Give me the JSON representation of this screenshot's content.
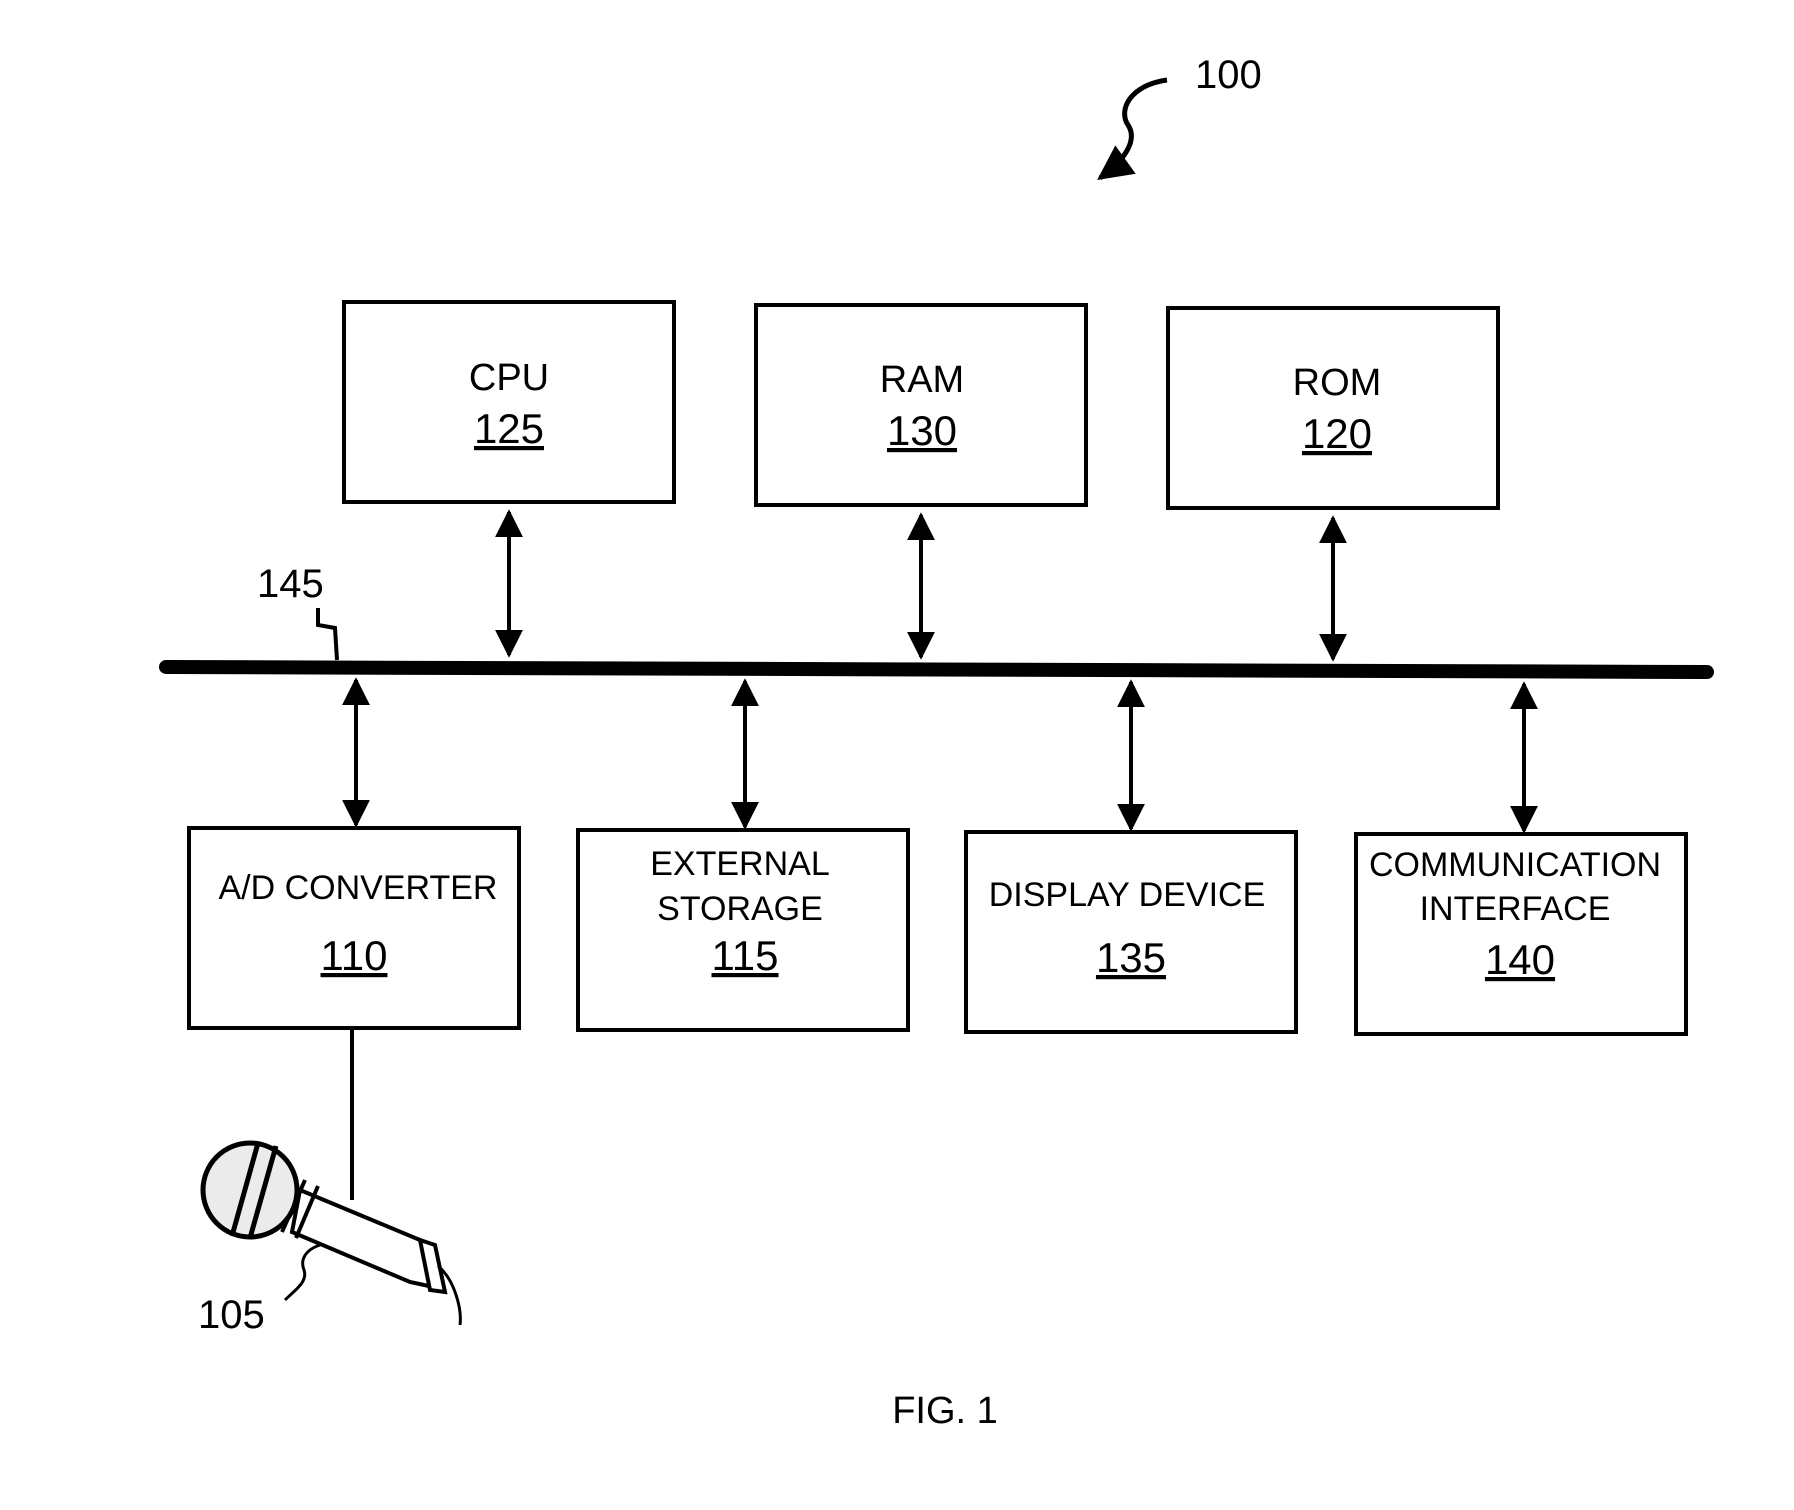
{
  "figure": {
    "caption": "FIG. 1",
    "system_ref": "100",
    "bus_ref": "145",
    "microphone_ref": "105"
  },
  "top_components": [
    {
      "name": "CPU",
      "ref": "125"
    },
    {
      "name": "RAM",
      "ref": "130"
    },
    {
      "name": "ROM",
      "ref": "120"
    }
  ],
  "bottom_components": [
    {
      "lines": [
        "A/D CONVERTER"
      ],
      "ref": "110"
    },
    {
      "lines": [
        "EXTERNAL",
        "STORAGE"
      ],
      "ref": "115"
    },
    {
      "lines": [
        "DISPLAY DEVICE"
      ],
      "ref": "135"
    },
    {
      "lines": [
        "COMMUNICATION",
        "INTERFACE"
      ],
      "ref": "140"
    }
  ],
  "colors": {
    "ink": "#000000",
    "paper": "#ffffff"
  }
}
